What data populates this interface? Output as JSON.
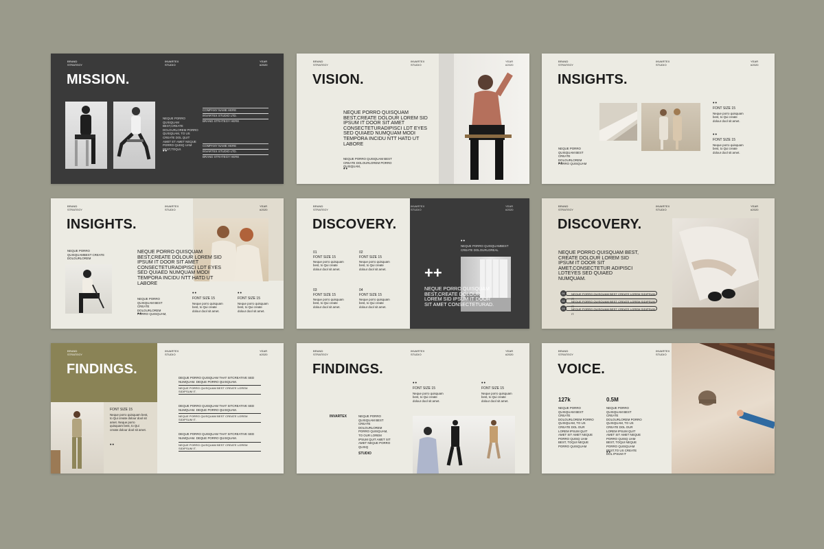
{
  "common": {
    "brand": "BRAND STRATEGY",
    "studio": "INVARTEX STUDIO",
    "year": "YEAR #2020",
    "dots": "••"
  },
  "s1": {
    "title": "MISSION.",
    "para": "NEQUE PORRO QUISQUAM BEST,CREATE DOLOURLOREM PORRO QUISQUAM, TO US CREATE DOL QUIT AMET ET AMET NEQUE PORRO QUISQ UAM BEST,TOQUI.",
    "rows1": [
      "COMPANY NAME HERE",
      "INVARTEX STUDIO LTD.",
      "BRAND STRATEGY HERE"
    ],
    "rows2": [
      "COMPANY NAME HERE",
      "INVARTEX STUDIO LTD.",
      "BRAND STRATEGY HERE"
    ]
  },
  "s2": {
    "title": "VISION.",
    "body": "NEQUE PORRO QUISQUAM BEST,CREATE DOLOUR LOREM SID IPSUM IT DOOR SIT AMET CONSECTETURADIPISCI LDT EYES SED QUIAED NUMQUAM MODI TEMPORA INCIDU NTT HATD UT LABORE",
    "small": "NEQUE PORRO QUISQUAM BEST CREATE DOLOURLOREM PORRO QUISQUAM,"
  },
  "s3": {
    "title": "INSIGHTS.",
    "small": "NEQUE PORRO QUISQUAM BEST CREATE DOLOURLOREM PORRO QUISQUAM",
    "items": [
      {
        "label": "FONT SIZE 15",
        "text": "Neque porro quisquam best, to Qui create dolour dool sit amet."
      },
      {
        "label": "FONT SIZE 15",
        "text": "Neque porro quisquam best, to Qui create dolour dool sit amet."
      }
    ]
  },
  "s4": {
    "title": "INSIGHTS.",
    "small1": "NEQUE PORRO QUISQUAMBEST CREATE DOLOURLOREM",
    "body": "NEQUE PORRO QUISQUAM BEST,CREATE DOLOUR LOREM SID IPSUM IT DOOR SIT AMET CONSECTETURADIPISCI LDT EYES SED QUIAED NUMQUAM MODI TEMPORA INCIDU NTT HATD UT LABORE",
    "small2": "NEQUE PORRO QUISQUAM BEST CREATE DOLOURLOREM PORRO QUISQUAM,",
    "items": [
      {
        "label": "FONT SIZE 15",
        "text": "Neque porro quisquam best, to Qui create dolour dool sit amet."
      },
      {
        "label": "FONT SIZE 15",
        "text": "Neque porro quisquam best, to Qui create dolour dool sit amet."
      }
    ]
  },
  "s5": {
    "title": "DISCOVERY.",
    "items": [
      {
        "num": "01",
        "label": "FONT SIZE 15",
        "text": "Neque porro quisquam best, to Qui create dolour dool sit amet."
      },
      {
        "num": "02",
        "label": "FONT SIZE 15",
        "text": "Neque porro quisquam best, to Qui create dolour dool sit amet."
      },
      {
        "num": "03",
        "label": "FONT SIZE 15",
        "text": "Neque porro quisquam best, to Qui create dolour dool sit amet."
      },
      {
        "num": "04",
        "label": "FONT SIZE 15",
        "text": "Neque porro quisquam best, to Qui create dolour dool sit amet."
      }
    ],
    "small": "NEQUE PORRO QUISQUAMBEST CREATE DOLOURLOREAL",
    "plus": "++",
    "body": "NEQUE PORRO QUISQUAM BEST,CREATE DOLOUR LOREM SID IPSUM IT DOOR SIT AMET CONSECTETURAD."
  },
  "s6": {
    "title": "DISCOVERY.",
    "body": "NEQUE PORRO QUISQUAM BEST, CREATE DOLOUR LOREM SID IPSUM IT DOOR SIT AMET,CONSECTETUR ADIPISCI LDTEYES SED QUIAED NUMQUAM.",
    "pills": [
      {
        "num": "01",
        "text": "NEQUE PORRO QUISQUAM  BEST CREATE LOREM SIDIPSUM IT."
      },
      {
        "num": "02",
        "text": "NEQUE PORRO QUISQUAM  BEST CREATE LOREM SIDIPSUM IT."
      },
      {
        "num": "03",
        "text": "NEQUE PORRO QUISQUAM  BEST CREATE LOREM SIDIPSUM IT."
      }
    ]
  },
  "s7": {
    "title": "FINDINGS.",
    "label": "FONT SIZE 15",
    "text": "Neque porro quisquam best, to Qui create dolour dool sit amet. Neque porro quisquam best, to Qui create dolour dool sit amet.",
    "groups": [
      {
        "head": "DEQUE PORRO QUISQUAM THAT SITCREATIVE SED NUMQUAM. DEQUE PORRO QUISQUAM.",
        "line": "NEQUE PORRO QUISQUAM  BEST CREATE LOREM SIDIPSUM IT."
      },
      {
        "head": "DEQUE PORRO QUISQUAM THAT SITCREATIVE SED NUMQUAM. DEQUE PORRO QUISQUAM.",
        "line": "NEQUE PORRO QUISQUAM  BEST CREATE LOREM SIDIPSUM IT."
      },
      {
        "head": "DEQUE PORRO QUISQUAM THAT SITCREATIVE SED NUMQUAM. DEQUE PORRO QUISQUAM.",
        "line": "NEQUE PORRO QUISQUAM  BEST CREATE LOREM SIDIPSUM IT."
      }
    ]
  },
  "s8": {
    "title": "FINDINGS.",
    "items": [
      {
        "label": "FONT SIZE 15",
        "text": "Neque porro quisquam best, to Qui create dolour dool sit amet."
      },
      {
        "label": "FONT SIZE 15",
        "text": "Neque porro quisquam best, to Qui create dolour dool sit amet."
      }
    ],
    "brand": "INVARTEX",
    "studio": "STUDIO",
    "small": "NEQUE PORRO QUISQUAM BEST CREATE DOLOURLOREM PORRO QUISQUAM, TO OUR LOREM IPSUM QUIT AMET SIT AMET NEQUE PORRO QUISQ"
  },
  "s9": {
    "title": "VOICE.",
    "stats": [
      {
        "value": "127k",
        "text": "NEQUE PORRO QUISQUAM BEST CREATE DOLOURLOREM PORRO QUISQUAM, TO US CREATE DOL OUR LOREM IPSUM QUIT AMET SIT AMET NEQUE PORRO QUISQ UAM BEST, TOQUI NEQUE PORRO QUISQUAM"
      },
      {
        "value": "0.5M",
        "text": "NEQUE PORRO QUISQUAM BEST CREATE DOLOURLOREM PORRO QUISQUAM, TO US CREATE DOL OUR LOREM IPSUM QUIT AMET SIT AMET NEQUE PORRO QUISQ UAM BEST, TOQUI NEQUE PORRO QUISQUAM BEST,TO US CREATE DOL IPSUM IT"
      }
    ]
  },
  "colors": {
    "backdrop": "#9a9a8b",
    "dark_slide": "#3a3a3a",
    "light_slide": "#ecebe3",
    "beige_slide": "#e1ddd1",
    "olive_accent": "#8a8356"
  }
}
